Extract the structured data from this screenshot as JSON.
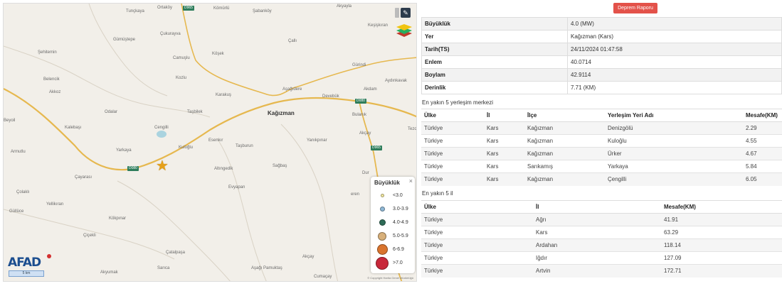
{
  "map": {
    "places": [
      {
        "name": "Tunçkaya",
        "cls": "place"
      },
      {
        "name": "Ortaköy",
        "cls": "place"
      },
      {
        "name": "Kömürlü",
        "cls": "place"
      },
      {
        "name": "Şabanköy",
        "cls": "place"
      },
      {
        "name": "Akyayla",
        "cls": "place"
      },
      {
        "name": "Keşişkıran",
        "cls": "place"
      },
      {
        "name": "Çukurayva",
        "cls": "place"
      },
      {
        "name": "Gümüştepe",
        "cls": "place"
      },
      {
        "name": "Çallı",
        "cls": "place"
      },
      {
        "name": "Şehitemin",
        "cls": "place"
      },
      {
        "name": "Camuşlu",
        "cls": "place"
      },
      {
        "name": "Köşek",
        "cls": "place"
      },
      {
        "name": "Gürindi",
        "cls": "place"
      },
      {
        "name": "Belencik",
        "cls": "place"
      },
      {
        "name": "Kozlu",
        "cls": "place"
      },
      {
        "name": "Aydınkavak",
        "cls": "place"
      },
      {
        "name": "Akkoz",
        "cls": "place"
      },
      {
        "name": "Karakuş",
        "cls": "place"
      },
      {
        "name": "Aşağıdere",
        "cls": "place"
      },
      {
        "name": "Akdam",
        "cls": "place"
      },
      {
        "name": "Devebük",
        "cls": "place"
      },
      {
        "name": "Odalar",
        "cls": "place"
      },
      {
        "name": "Taşbilek",
        "cls": "place"
      },
      {
        "name": "Kağızman",
        "cls": "place town"
      },
      {
        "name": "Bulanık",
        "cls": "place"
      },
      {
        "name": "Beyoil",
        "cls": "place"
      },
      {
        "name": "Kalebaşı",
        "cls": "place"
      },
      {
        "name": "Cengilli",
        "cls": "place"
      },
      {
        "name": "Esenkır",
        "cls": "place"
      },
      {
        "name": "Akçay",
        "cls": "place"
      },
      {
        "name": "Taşburun",
        "cls": "place"
      },
      {
        "name": "Yanıkpınar",
        "cls": "place"
      },
      {
        "name": "Kuloğlu",
        "cls": "place"
      },
      {
        "name": "Armutlu",
        "cls": "place"
      },
      {
        "name": "Yarkaya",
        "cls": "place"
      },
      {
        "name": "Altıngedik",
        "cls": "place"
      },
      {
        "name": "Sağbaş",
        "cls": "place"
      },
      {
        "name": "Çayarası",
        "cls": "place"
      },
      {
        "name": "Evyapan",
        "cls": "place"
      },
      {
        "name": "Çolaklı",
        "cls": "place"
      },
      {
        "name": "Yellikıran",
        "cls": "place"
      },
      {
        "name": "Güllüce",
        "cls": "place"
      },
      {
        "name": "Kökpınar",
        "cls": "place"
      },
      {
        "name": "Çiçekli",
        "cls": "place"
      },
      {
        "name": "Çatalpaşa",
        "cls": "place"
      },
      {
        "name": "Akçay",
        "cls": "place"
      },
      {
        "name": "Akyumak",
        "cls": "place"
      },
      {
        "name": "Sarıca",
        "cls": "place"
      },
      {
        "name": "Aşağı Pamuktaş",
        "cls": "place"
      },
      {
        "name": "Cumaçay",
        "cls": "place"
      },
      {
        "name": "Tezc",
        "cls": "place"
      },
      {
        "name": "Dur",
        "cls": "place"
      },
      {
        "name": "eren",
        "cls": "place"
      }
    ],
    "shields": [
      "D965",
      "D080",
      "D080",
      "D965"
    ],
    "logo": "AFAD",
    "scale_label": "5 km",
    "copyright": "© Copyright Harita Genel Müdürlüğü"
  },
  "legend": {
    "title": "Büyüklük",
    "close": "×",
    "items": [
      {
        "label": "<3.0",
        "color": "#f3e9a0",
        "size": 5
      },
      {
        "label": "3.0-3.9",
        "color": "#8fb8d6",
        "size": 7
      },
      {
        "label": "4.0-4.9",
        "color": "#2e6b57",
        "size": 9
      },
      {
        "label": "5.0-5.9",
        "color": "#d8b07a",
        "size": 12
      },
      {
        "label": "6-6.9",
        "color": "#d9742e",
        "size": 15
      },
      {
        "label": ">7.0",
        "color": "#c8283a",
        "size": 18
      }
    ]
  },
  "report_button": "Deprem Raporu",
  "info": [
    {
      "k": "Büyüklük",
      "v": "4.0 (MW)"
    },
    {
      "k": "Yer",
      "v": "Kağızman (Kars)"
    },
    {
      "k": "Tarih(TS)",
      "v": "24/11/2024 01:47:58"
    },
    {
      "k": "Enlem",
      "v": "40.0714"
    },
    {
      "k": "Boylam",
      "v": "42.9114"
    },
    {
      "k": "Derinlik",
      "v": "7.71 (KM)"
    }
  ],
  "nearest_settlements": {
    "title": "En yakın 5 yerleşim merkezi",
    "headers": [
      "Ülke",
      "İl",
      "İlçe",
      "Yerleşim Yeri Adı",
      "Mesafe(KM)"
    ],
    "rows": [
      [
        "Türkiye",
        "Kars",
        "Kağızman",
        "Denizgölü",
        "2.29"
      ],
      [
        "Türkiye",
        "Kars",
        "Kağızman",
        "Kuloğlu",
        "4.55"
      ],
      [
        "Türkiye",
        "Kars",
        "Kağızman",
        "Ürker",
        "4.67"
      ],
      [
        "Türkiye",
        "Kars",
        "Sarıkamış",
        "Yarkaya",
        "5.84"
      ],
      [
        "Türkiye",
        "Kars",
        "Kağızman",
        "Çengilli",
        "6.05"
      ]
    ]
  },
  "nearest_provinces": {
    "title": "En yakın 5 il",
    "headers": [
      "Ülke",
      "İl",
      "Mesafe(KM)"
    ],
    "rows": [
      [
        "Türkiye",
        "Ağrı",
        "41.91"
      ],
      [
        "Türkiye",
        "Kars",
        "63.29"
      ],
      [
        "Türkiye",
        "Ardahan",
        "118.14"
      ],
      [
        "Türkiye",
        "Iğdır",
        "127.09"
      ],
      [
        "Türkiye",
        "Artvin",
        "172.71"
      ]
    ]
  }
}
